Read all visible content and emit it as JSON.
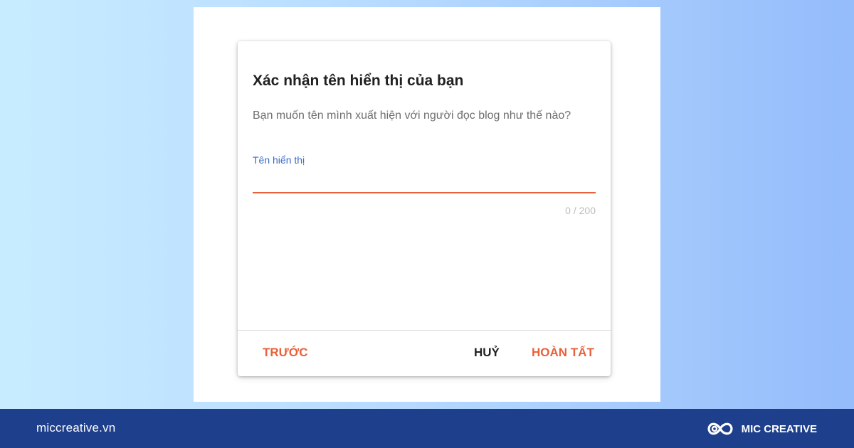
{
  "dialog": {
    "title": "Xác nhận tên hiển thị của bạn",
    "description": "Bạn muốn tên mình xuất hiện với người đọc blog như thế nào?",
    "field": {
      "label": "Tên hiển thị",
      "value": "",
      "counter": "0 / 200"
    },
    "buttons": {
      "prev": "TRƯỚC",
      "cancel": "HUỶ",
      "finish": "HOÀN TẤT"
    }
  },
  "footer": {
    "site": "miccreative.vn",
    "brand": "MIC CREATIVE"
  },
  "colors": {
    "accent": "#e8613a",
    "label_blue": "#3b6bc9",
    "footer_bg": "#1d3f8c"
  },
  "icons": {
    "brand_logo": "infinity-loop-logo-icon"
  }
}
